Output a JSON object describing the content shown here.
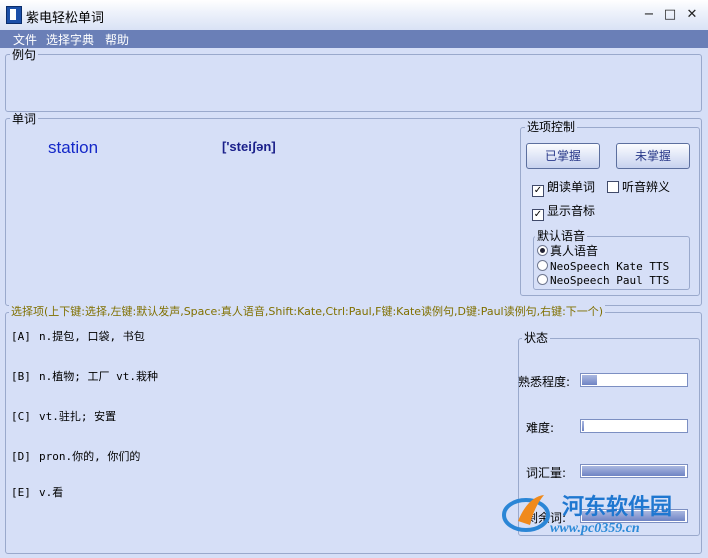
{
  "window": {
    "title": "紫电轻松单词",
    "minimize": "−",
    "maximize": "□",
    "close": "✕"
  },
  "menu": [
    "文件",
    "选择字典",
    "帮助"
  ],
  "example": {
    "legend": "例句"
  },
  "word_panel": {
    "legend": "单词",
    "word": "station",
    "phonetic": "['steiʃən]"
  },
  "options_control": {
    "legend": "选项控制",
    "mastered_button": "已掌握",
    "not_mastered_button": "未掌握",
    "read_word": {
      "label": "朗读单词",
      "checked": true
    },
    "listen_meaning": {
      "label": "听音辨义",
      "checked": false
    },
    "show_phonetic": {
      "label": "显示音标",
      "checked": true
    },
    "default_voice": {
      "legend": "默认语音",
      "options": [
        {
          "label": "真人语音",
          "selected": true
        },
        {
          "label": "NeoSpeech Kate TTS",
          "selected": false
        },
        {
          "label": "NeoSpeech Paul TTS",
          "selected": false
        }
      ]
    }
  },
  "choices": {
    "legend": "选择项(上下键:选择,左键:默认发声,Space:真人语音,Shift:Kate,Ctrl:Paul,F键:Kate读例句,D键:Paul读例句,右键:下一个)",
    "items": [
      {
        "letter": "[A]",
        "text": "n.提包, 口袋, 书包"
      },
      {
        "letter": "[B]",
        "text": "n.植物; 工厂 vt.栽种"
      },
      {
        "letter": "[C]",
        "text": "vt.驻扎; 安置"
      },
      {
        "letter": "[D]",
        "text": "pron.你的, 你们的"
      },
      {
        "letter": "[E]",
        "text": "v.看"
      }
    ]
  },
  "status": {
    "legend": "状态",
    "items": [
      {
        "label": "熟悉程度:",
        "fraction": 0.14
      },
      {
        "label": "难度:",
        "fraction": 0.0
      },
      {
        "label": "词汇量:",
        "fraction": 0.99
      },
      {
        "label": "剩余词:",
        "fraction": 0.99
      }
    ]
  },
  "watermark": {
    "name": "河东软件园",
    "url": "www.pc0359.cn"
  }
}
